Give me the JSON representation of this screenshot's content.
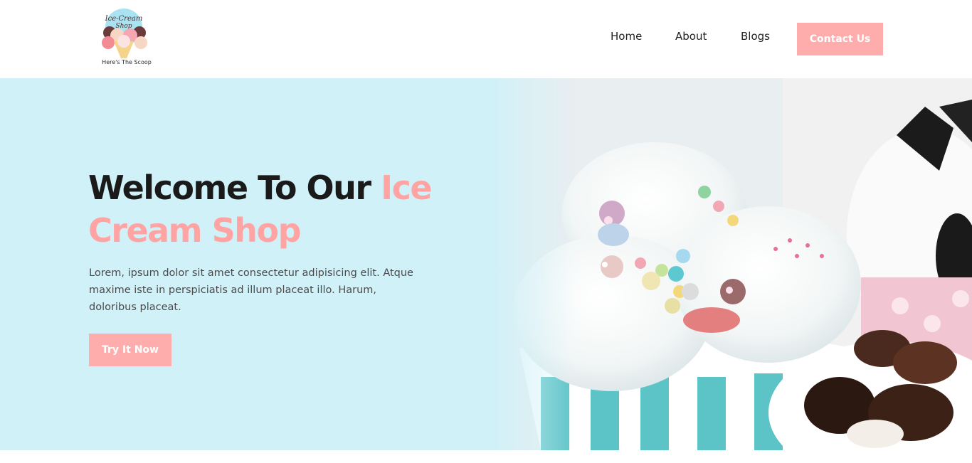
{
  "header": {
    "logo_title_line1": "Ice-Cream",
    "logo_title_line2": "Shop",
    "logo_tagline": "Here's The Scoop",
    "nav": [
      {
        "label": "Home"
      },
      {
        "label": "About"
      },
      {
        "label": "Blogs"
      }
    ],
    "contact_label": "Contact Us"
  },
  "hero": {
    "title_part1": "Welcome To Our ",
    "title_accent": "Ice Cream Shop",
    "description": "Lorem, ipsum dolor sit amet consectetur adipisicing elit. Atque maxime iste in perspiciatis ad illum placeat illo. Harum, doloribus placeat.",
    "cta_label": "Try It Now"
  },
  "colors": {
    "accent": "#ffacac",
    "hero_bg": "#d1f1f8"
  }
}
